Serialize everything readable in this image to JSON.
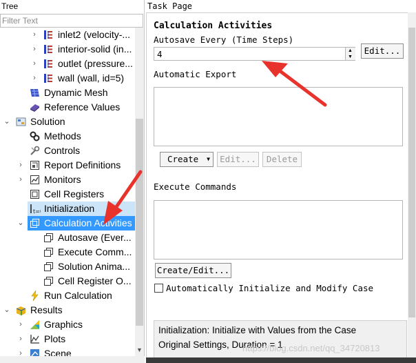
{
  "tree": {
    "header": "Tree",
    "filter_placeholder": "Filter Text",
    "items": [
      {
        "label": "inlet2 (velocity-...",
        "icon": "boundary-icon"
      },
      {
        "label": "interior-solid (in...",
        "icon": "boundary-icon"
      },
      {
        "label": "outlet (pressure...",
        "icon": "boundary-icon"
      },
      {
        "label": "wall (wall, id=5)",
        "icon": "boundary-icon"
      },
      {
        "label": "Dynamic Mesh",
        "icon": "dynamic-mesh-icon"
      },
      {
        "label": "Reference Values",
        "icon": "reference-values-icon"
      },
      {
        "label": "Solution",
        "icon": "solution-icon"
      },
      {
        "label": "Methods",
        "icon": "methods-icon"
      },
      {
        "label": "Controls",
        "icon": "controls-icon"
      },
      {
        "label": "Report Definitions",
        "icon": "report-icon"
      },
      {
        "label": "Monitors",
        "icon": "monitors-icon"
      },
      {
        "label": "Cell Registers",
        "icon": "cell-registers-icon"
      },
      {
        "label": "Initialization",
        "icon": "initialization-icon"
      },
      {
        "label": "Calculation Activities",
        "icon": "calculation-activities-icon"
      },
      {
        "label": "Autosave (Ever...",
        "icon": "activity-icon"
      },
      {
        "label": "Execute Comm...",
        "icon": "activity-icon"
      },
      {
        "label": "Solution Anima...",
        "icon": "activity-icon"
      },
      {
        "label": "Cell Register O...",
        "icon": "activity-icon"
      },
      {
        "label": "Run Calculation",
        "icon": "run-calculation-icon"
      },
      {
        "label": "Results",
        "icon": "results-icon"
      },
      {
        "label": "Graphics",
        "icon": "graphics-icon"
      },
      {
        "label": "Plots",
        "icon": "plots-icon"
      },
      {
        "label": "Scene",
        "icon": "scene-icon"
      }
    ]
  },
  "task": {
    "header": "Task Page",
    "title": "Calculation Activities",
    "autosave_label": "Autosave Every (Time Steps)",
    "autosave_value": "4",
    "autosave_edit": "Edit...",
    "auto_export_label": "Automatic Export",
    "create_label": "Create",
    "edit_label": "Edit...",
    "delete_label": "Delete",
    "execute_label": "Execute Commands",
    "create_edit_label": "Create/Edit...",
    "auto_init_label": "Automatically Initialize and Modify Case",
    "init_line1": "Initialization: Initialize with Values from the Case",
    "init_line2": "Original Settings, Duration = 1"
  },
  "watermark": "https://blog.csdn.net/qq_34720813",
  "colors": {
    "selection": "#3399ff",
    "annotation_arrow": "#e8332c"
  }
}
